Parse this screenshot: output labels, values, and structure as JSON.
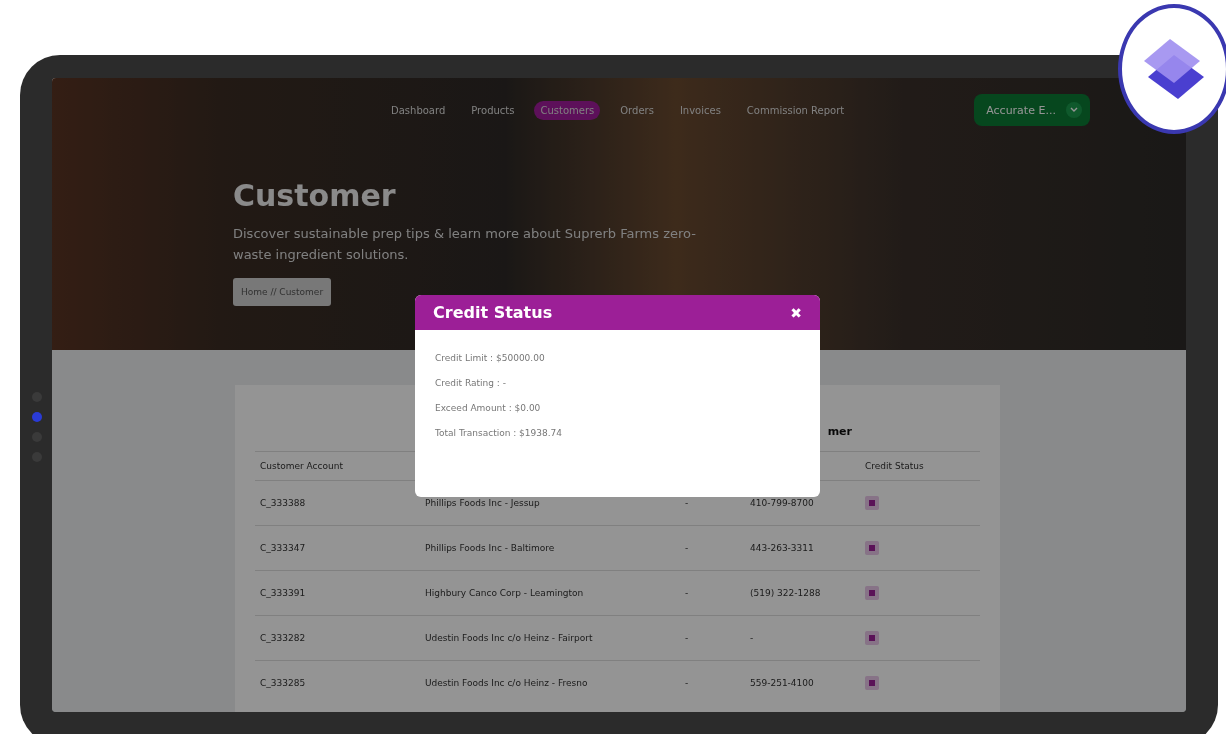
{
  "nav": {
    "links": [
      {
        "label": "Dashboard",
        "selected": false
      },
      {
        "label": "Products",
        "selected": false
      },
      {
        "label": "Customers",
        "selected": true
      },
      {
        "label": "Orders",
        "selected": false
      },
      {
        "label": "Invoices",
        "selected": false
      },
      {
        "label": "Commission Report",
        "selected": false
      }
    ],
    "account": "Accurate E..."
  },
  "hero": {
    "title": "Customer",
    "subtitle": "Discover sustainable prep tips & learn more about Suprerb Farms zero-waste ingredient solutions.",
    "breadcrumb": "Home // Customer"
  },
  "card": {
    "title": "mer",
    "columns": [
      "Customer Account",
      "Credit Status"
    ],
    "rows": [
      {
        "account": "C_333388",
        "name": "Phillips Foods Inc - Jessup",
        "column_3": "-",
        "phone": "410-799-8700"
      },
      {
        "account": "C_333347",
        "name": "Phillips Foods Inc - Baltimore",
        "column_3": "-",
        "phone": "443-263-3311"
      },
      {
        "account": "C_333391",
        "name": "Highbury Canco Corp - Leamington",
        "column_3": "-",
        "phone": "(519) 322-1288"
      },
      {
        "account": "C_333282",
        "name": "Udestin Foods Inc c/o Heinz - Fairport",
        "column_3": "-",
        "phone": "-"
      },
      {
        "account": "C_333285",
        "name": "Udestin Foods Inc c/o Heinz - Fresno",
        "column_3": "-",
        "phone": "559-251-4100"
      }
    ]
  },
  "pager_dots": [
    {
      "selected": false
    },
    {
      "selected": true
    },
    {
      "selected": false
    },
    {
      "selected": false
    }
  ],
  "modal": {
    "title": "Credit Status",
    "close": "✖",
    "lines": [
      "Credit Limit : $50000.00",
      "Credit Rating : -",
      "Exceed Amount : $0.00",
      "Total Transaction : $1938.74"
    ]
  }
}
